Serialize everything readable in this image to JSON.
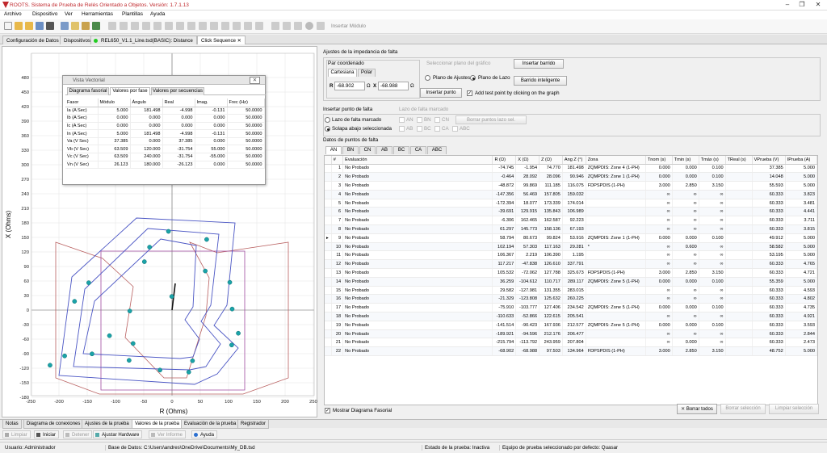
{
  "app_title": "ROOTS. Sistema de Prueba de Relés Orientado a Objetos. Versión: 1.7.1.13",
  "menu": [
    "Archivo",
    "Dispositivo",
    "Ver",
    "Herramientas",
    "Plantillas",
    "Ayuda"
  ],
  "toolbar_module": "Insertar Módulo",
  "doc_tabs": [
    "Configuración de Datos",
    "Dispositivos",
    "REL650_V1.1_Line.tsd(BASIC): Distance",
    "Click Sequence"
  ],
  "graph": {
    "xlabel": "R (Ohms)",
    "ylabel": "X (Ohms)",
    "xticks": [
      "-250",
      "-200",
      "-150",
      "-100",
      "-50",
      "0",
      "50",
      "100",
      "150",
      "200",
      "250"
    ],
    "yticks": [
      "480",
      "450",
      "420",
      "390",
      "360",
      "330",
      "300",
      "270",
      "240",
      "210",
      "180",
      "150",
      "120",
      "90",
      "60",
      "30",
      "0",
      "-30",
      "-60",
      "-90",
      "-120",
      "-150",
      "-180"
    ]
  },
  "vector_view": {
    "title": "Vista Vectorial",
    "tabs": [
      "Diagrama fasorial",
      "Valores por fase",
      "Valores por secuencias"
    ],
    "columns": [
      "Fasor",
      "Módulo",
      "Ángulo",
      "Real",
      "Imag.",
      "Frec (Hz)"
    ],
    "rows": [
      [
        "Ia (A Sec)",
        "5.000",
        "181.498",
        "-4.998",
        "-0.131",
        "50.0000"
      ],
      [
        "Ib (A Sec)",
        "0.000",
        "0.000",
        "0.000",
        "0.000",
        "50.0000"
      ],
      [
        "Ic (A Sec)",
        "0.000",
        "0.000",
        "0.000",
        "0.000",
        "50.0000"
      ],
      [
        "In (A Sec)",
        "5.000",
        "181.498",
        "-4.998",
        "-0.131",
        "50.0000"
      ],
      [
        "Va (V Sec)",
        "37.385",
        "0.000",
        "37.385",
        "0.000",
        "50.0000"
      ],
      [
        "Vb (V Sec)",
        "63.509",
        "120.000",
        "-31.754",
        "55.000",
        "50.0000"
      ],
      [
        "Vc (V Sec)",
        "63.509",
        "240.000",
        "-31.754",
        "-55.000",
        "50.0000"
      ],
      [
        "Vn (V Sec)",
        "26.123",
        "180.000",
        "-26.123",
        "0.000",
        "50.0000"
      ]
    ]
  },
  "impedance": {
    "title": "Ajustes de la impedancia de falta",
    "pair_title": "Par coordenado",
    "tab_cart": "Cartesiana",
    "tab_polar": "Polar",
    "r_label": "R",
    "r_value": "-68.902",
    "x_label": "X",
    "x_value": "-68.988",
    "unit": "Ω",
    "plane_title": "Seleccionar plano del gráfico",
    "plane_opt1": "Plano de Ajustes",
    "plane_opt2": "Plano de Lazo",
    "btn_insert_sweep": "Insertar barrido",
    "btn_smart_sweep": "Barrido inteligente",
    "btn_insert_point": "Insertar punto",
    "chk_add_click": "Add test point by clicking on the graph"
  },
  "fault_point": {
    "title": "Insertar punto de falta",
    "opt1": "Lazo de falta marcado",
    "opt2": "Solapa abajo seleccionada",
    "loop_title": "Lazo de falta marcado",
    "loops": [
      "AN",
      "BN",
      "CN",
      "AB",
      "BC",
      "CA",
      "ABC"
    ],
    "btn_clear_loop": "Borrar puntos lazo sel."
  },
  "points": {
    "title": "Datos de puntos de falta",
    "tabs": [
      "AN",
      "BN",
      "CN",
      "AB",
      "BC",
      "CA",
      "ABC"
    ],
    "columns": [
      "#",
      "Evaluación",
      "R (Ω)",
      "X (Ω)",
      "Z (Ω)",
      "Ang Z (°)",
      "Zona",
      "Tnom (s)",
      "Tmin (s)",
      "Tmáx (s)",
      "TReal (s)",
      "VPrueba (V)",
      "IPrueba (A)"
    ],
    "rows": [
      [
        "1",
        "No Probado",
        "-74.745",
        "-1.954",
        "74.770",
        "181.498",
        "ZQMPDIS: Zone 4  (1-PH)",
        "0.000",
        "0.000",
        "0.100",
        "",
        "37.385",
        "5.000"
      ],
      [
        "2",
        "No Probado",
        "-0.464",
        "28.092",
        "28.096",
        "90.946",
        "ZQMPDIS: Zone 1  (1-PH)",
        "0.000",
        "0.000",
        "0.100",
        "",
        "14.048",
        "5.000"
      ],
      [
        "3",
        "No Probado",
        "-48.872",
        "99.869",
        "111.185",
        "116.075",
        "FDPSPDIS      (1-PH)",
        "3.000",
        "2.850",
        "3.150",
        "",
        "55.593",
        "5.000"
      ],
      [
        "4",
        "No Probado",
        "-147.356",
        "56.469",
        "157.805",
        "159.032",
        "",
        "∞",
        "∞",
        "∞",
        "",
        "60.333",
        "3.823"
      ],
      [
        "5",
        "No Probado",
        "-172.394",
        "18.077",
        "173.339",
        "174.014",
        "",
        "∞",
        "∞",
        "∞",
        "",
        "60.333",
        "3.481"
      ],
      [
        "6",
        "No Probado",
        "-39.691",
        "129.915",
        "135.843",
        "106.989",
        "",
        "∞",
        "∞",
        "∞",
        "",
        "60.333",
        "4.441"
      ],
      [
        "7",
        "No Probado",
        "-6.306",
        "162.465",
        "162.587",
        "92.223",
        "",
        "∞",
        "∞",
        "∞",
        "",
        "60.333",
        "3.711"
      ],
      [
        "8",
        "No Probado",
        "61.297",
        "145.773",
        "158.136",
        "67.193",
        "",
        "∞",
        "∞",
        "∞",
        "",
        "60.333",
        "3.815"
      ],
      [
        "9",
        "No Probado",
        "58.794",
        "80.673",
        "99.824",
        "53.916",
        "ZQMPDIS: Zone 1  (1-PH)",
        "0.000",
        "0.000",
        "0.100",
        "",
        "49.912",
        "5.000"
      ],
      [
        "10",
        "No Probado",
        "102.194",
        "57.303",
        "117.163",
        "29.281",
        "*",
        "∞",
        "0.600",
        "∞",
        "",
        "58.582",
        "5.000"
      ],
      [
        "11",
        "No Probado",
        "106.367",
        "2.219",
        "106.390",
        "1.195",
        "",
        "∞",
        "∞",
        "∞",
        "",
        "53.195",
        "5.000"
      ],
      [
        "12",
        "No Probado",
        "117.217",
        "-47.838",
        "126.610",
        "337.791",
        "",
        "∞",
        "∞",
        "∞",
        "",
        "60.333",
        "4.765"
      ],
      [
        "13",
        "No Probado",
        "105.532",
        "-72.062",
        "127.788",
        "325.673",
        "FDPSPDIS      (1-PH)",
        "3.000",
        "2.850",
        "3.150",
        "",
        "60.333",
        "4.721"
      ],
      [
        "14",
        "No Probado",
        "36.259",
        "-104.612",
        "110.717",
        "289.117",
        "ZQMPDIS: Zone 5  (1-PH)",
        "0.000",
        "0.000",
        "0.100",
        "",
        "55.359",
        "5.000"
      ],
      [
        "15",
        "No Probado",
        "29.582",
        "-127.981",
        "131.355",
        "283.015",
        "",
        "∞",
        "∞",
        "∞",
        "",
        "60.333",
        "4.593"
      ],
      [
        "16",
        "No Probado",
        "-21.329",
        "-123.808",
        "125.632",
        "260.225",
        "",
        "∞",
        "∞",
        "∞",
        "",
        "60.333",
        "4.802"
      ],
      [
        "17",
        "No Probado",
        "-75.910",
        "-103.777",
        "127.406",
        "234.542",
        "ZQMPDIS: Zone 5  (1-PH)",
        "0.000",
        "0.000",
        "0.100",
        "",
        "60.333",
        "4.735"
      ],
      [
        "18",
        "No Probado",
        "-110.633",
        "-52.866",
        "122.615",
        "205.541",
        "",
        "∞",
        "∞",
        "∞",
        "",
        "60.333",
        "4.921"
      ],
      [
        "19",
        "No Probado",
        "-141.514",
        "-90.423",
        "167.936",
        "212.577",
        "ZQMPDIS: Zone 5  (1-PH)",
        "0.000",
        "0.000",
        "0.100",
        "",
        "60.333",
        "3.593"
      ],
      [
        "20",
        "No Probado",
        "-189.921",
        "-94.596",
        "212.176",
        "206.477",
        "",
        "∞",
        "∞",
        "∞",
        "",
        "60.333",
        "2.844"
      ],
      [
        "21",
        "No Probado",
        "-215.794",
        "-113.792",
        "243.959",
        "207.804",
        "",
        "∞",
        "0.000",
        "∞",
        "",
        "60.333",
        "2.473"
      ],
      [
        "22",
        "No Probado",
        "-68.902",
        "-68.988",
        "97.503",
        "134.964",
        "FDPSPDIS      (1-PH)",
        "3.000",
        "2.850",
        "3.150",
        "",
        "48.752",
        "5.000"
      ]
    ]
  },
  "show_phasor": "Mostrar Diagrama Fasorial",
  "btn_clear_all": "Borrar todos",
  "btn_clear_sel": "Borrar selección",
  "btn_clean_sel": "Limpiar selección",
  "bottom_tabs": [
    "Notas",
    "Diagrama de conexiones",
    "Ajustes de la prueba",
    "Valores de la prueba",
    "Evaluación de la prueba",
    "Registrador"
  ],
  "controls": [
    "Limpiar",
    "Iniciar",
    "Detener",
    "Ajustar Hardware",
    "Ver Informe",
    "Ayuda"
  ],
  "status": {
    "user": "Usuario: Administrador",
    "db": "Base de Datos:  C:\\Users\\andres\\OneDrive\\Documents\\My_DB.tsd",
    "state": "Estado de la prueba: Inactiva",
    "equipment": "Equipo de prueba seleccionado por defecto: Quasar"
  }
}
